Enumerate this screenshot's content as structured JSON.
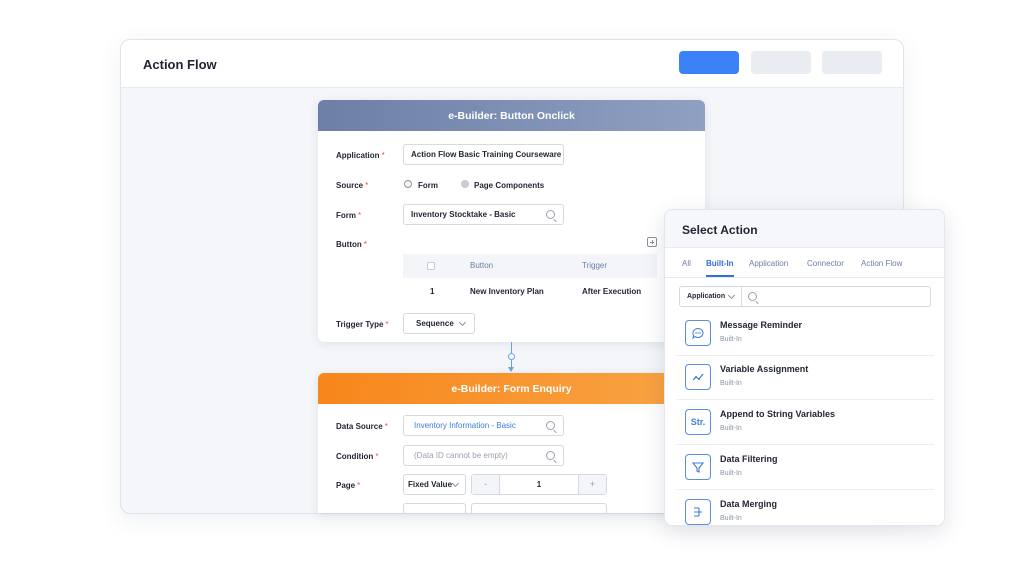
{
  "window": {
    "title": "Action Flow"
  },
  "card1": {
    "title": "e-Builder: Button Onclick",
    "application_label": "Application",
    "application_value": "Action Flow Basic Training Courseware",
    "source_label": "Source",
    "source_options": [
      "Form",
      "Page Components"
    ],
    "form_label": "Form",
    "form_value": "Inventory Stocktake - Basic",
    "button_label": "Button",
    "table": {
      "headers": [
        "Button",
        "Trigger"
      ],
      "rows": [
        {
          "index": "1",
          "button": "New Inventory Plan",
          "trigger": "After Execution"
        }
      ]
    },
    "trigger_type_label": "Trigger Type",
    "trigger_type_value": "Sequence"
  },
  "card2": {
    "title": "e-Builder: Form Enquiry",
    "data_source_label": "Data Source",
    "data_source_value": "Inventory Information - Basic",
    "condition_label": "Condition",
    "condition_placeholder": "(Data ID cannot be empty)",
    "page_label": "Page",
    "page_mode": "Fixed Value",
    "page_minus": "-",
    "page_value": "1",
    "page_plus": "+"
  },
  "panel": {
    "title": "Select Action",
    "tabs": [
      "All",
      "Built-In",
      "Application",
      "Connector",
      "Action Flow"
    ],
    "active_tab": "Built-In",
    "filter_select": "Application",
    "items": [
      {
        "name": "Message Reminder",
        "sub": "Built-In",
        "icon": "chat-icon"
      },
      {
        "name": "Variable Assignment",
        "sub": "Built-In",
        "icon": "variable-icon"
      },
      {
        "name": "Append to String Variables",
        "sub": "Built-In",
        "icon": "str-icon",
        "icon_text": "Str."
      },
      {
        "name": "Data Filtering",
        "sub": "Built-In",
        "icon": "filter-icon"
      },
      {
        "name": "Data Merging",
        "sub": "Built-In",
        "icon": "merge-icon"
      }
    ]
  },
  "colors": {
    "accent": "#3b82f6",
    "card1_header": "#7b8db3",
    "card2_header": "#f7861b",
    "required": "#f04b4b"
  }
}
